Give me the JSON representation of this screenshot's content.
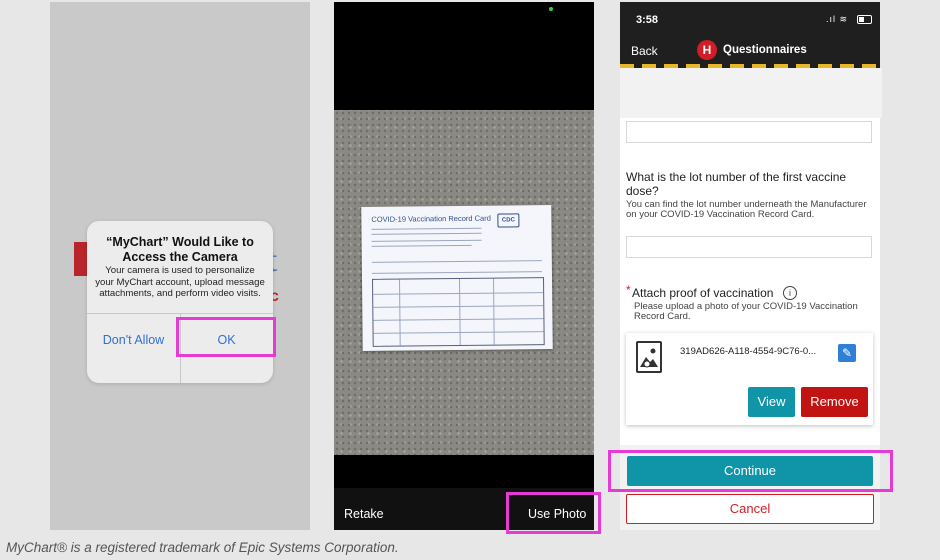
{
  "phone1": {
    "alert_title_1": "“MyChart” Would Like to",
    "alert_title_2": "Access the Camera",
    "alert_message": "Your camera is used to personalize your MyChart account, upload message attachments, and perform video visits.",
    "dont_allow_label": "Don't Allow",
    "ok_label": "OK"
  },
  "phone2": {
    "card_title": "COVID-19 Vaccination Record Card",
    "cdc_label": "CDC",
    "retake_label": "Retake",
    "use_photo_label": "Use Photo"
  },
  "phone3": {
    "time": "3:58",
    "back_label": "Back",
    "h_icon_letter": "H",
    "header_title": "Questionnaires",
    "question_lot": "What is the lot number of the first vaccine dose?",
    "question_lot_help": "You can find the lot number underneath the Manufacturer on your COVID-19 Vaccination Record Card.",
    "required_star": "*",
    "question_attach": "Attach proof of vaccination",
    "question_attach_help": "Please upload a photo of your COVID-19 Vaccination Record Card.",
    "file_name": "319AD626-A118-4554-9C76-0...",
    "view_label": "View",
    "remove_label": "Remove",
    "continue_label": "Continue",
    "cancel_label": "Cancel"
  },
  "footer_text": "MyChart® is a registered trademark of Epic Systems Corporation.",
  "colors": {
    "highlight": "#e63ad7",
    "teal_button": "#0f94a8",
    "red_button": "#c21313",
    "ios_blue": "#2f6fd6"
  }
}
